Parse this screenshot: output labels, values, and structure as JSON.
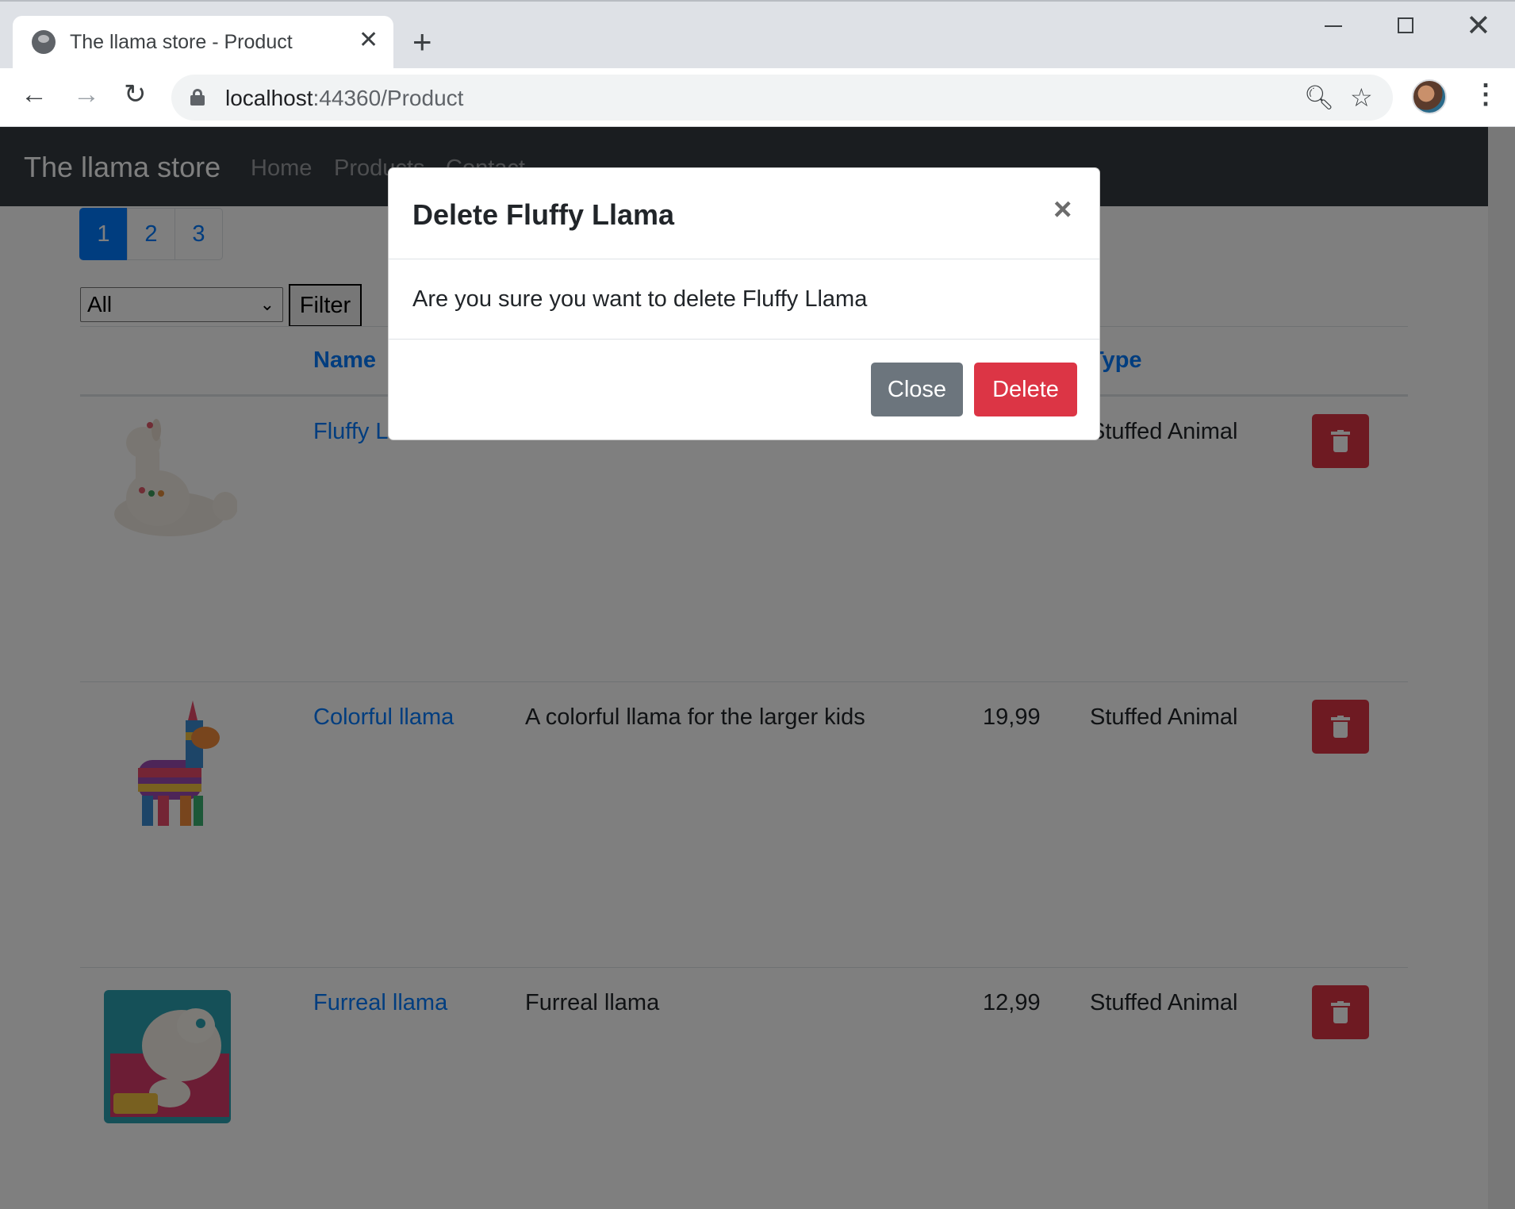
{
  "browser": {
    "tab_title": "The llama store - Product",
    "url_host": "localhost",
    "url_path": ":44360/Product"
  },
  "navbar": {
    "brand": "The llama store",
    "links": [
      "Home",
      "Products",
      "Contact"
    ]
  },
  "pagination": {
    "pages": [
      "1",
      "2",
      "3"
    ],
    "active": "1"
  },
  "filter": {
    "selected": "All",
    "button": "Filter"
  },
  "table": {
    "headers": {
      "name": "Name",
      "type": "Type"
    },
    "rows": [
      {
        "name": "Fluffy Llama",
        "description": "",
        "price": "",
        "type": "Stuffed Animal",
        "image": "white-plush-llama"
      },
      {
        "name": "Colorful llama",
        "description": "A colorful llama for the larger kids",
        "price": "19,99",
        "type": "Stuffed Animal",
        "image": "rainbow-pinata-llama"
      },
      {
        "name": "Furreal llama",
        "description": "Furreal llama",
        "price": "12,99",
        "type": "Stuffed Animal",
        "image": "furreal-boxed-llama"
      }
    ]
  },
  "modal": {
    "title": "Delete Fluffy Llama",
    "body": "Are you sure you want to delete Fluffy Llama",
    "close_label": "Close",
    "delete_label": "Delete",
    "dismiss_glyph": "×"
  },
  "colors": {
    "primary": "#007bff",
    "danger": "#dc3545",
    "secondary": "#6c757d",
    "navbar": "#343a40"
  }
}
